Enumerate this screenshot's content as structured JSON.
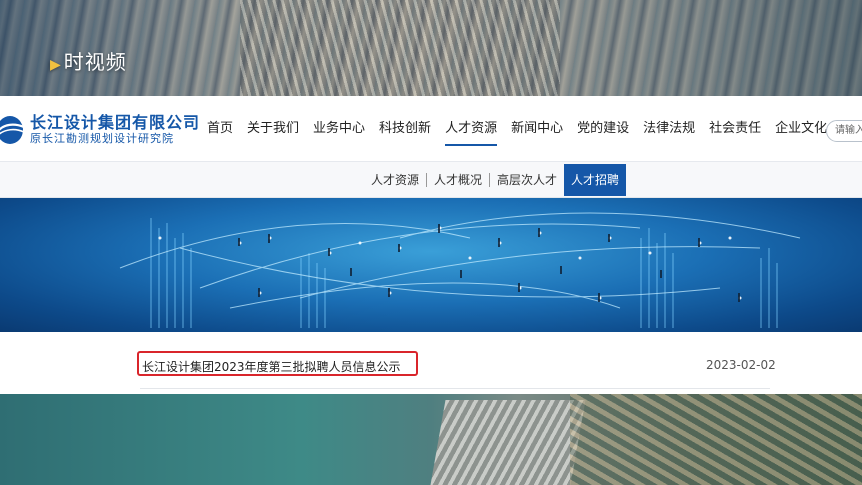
{
  "video": {
    "watermark": "时视频"
  },
  "brand": {
    "name": "长江设计集团有限公司",
    "sub": "原长江勘测规划设计研究院",
    "accent": "#1557a8"
  },
  "nav": {
    "items": [
      {
        "label": "首页"
      },
      {
        "label": "关于我们"
      },
      {
        "label": "业务中心"
      },
      {
        "label": "科技创新"
      },
      {
        "label": "人才资源"
      },
      {
        "label": "新闻中心"
      },
      {
        "label": "党的建设"
      },
      {
        "label": "法律法规"
      },
      {
        "label": "社会责任"
      },
      {
        "label": "企业文化"
      }
    ],
    "active": "人才资源"
  },
  "search": {
    "placeholder": "请输入"
  },
  "subnav": {
    "items": [
      {
        "label": "人才资源"
      },
      {
        "label": "人才概况"
      },
      {
        "label": "高层次人才"
      },
      {
        "label": "人才招聘"
      }
    ],
    "active": "人才招聘"
  },
  "list": {
    "rows": [
      {
        "title": "长江设计集团2023年度第三批拟聘人员信息公示",
        "date": "2023-02-02"
      }
    ],
    "highlight_color": "#d9252b"
  }
}
